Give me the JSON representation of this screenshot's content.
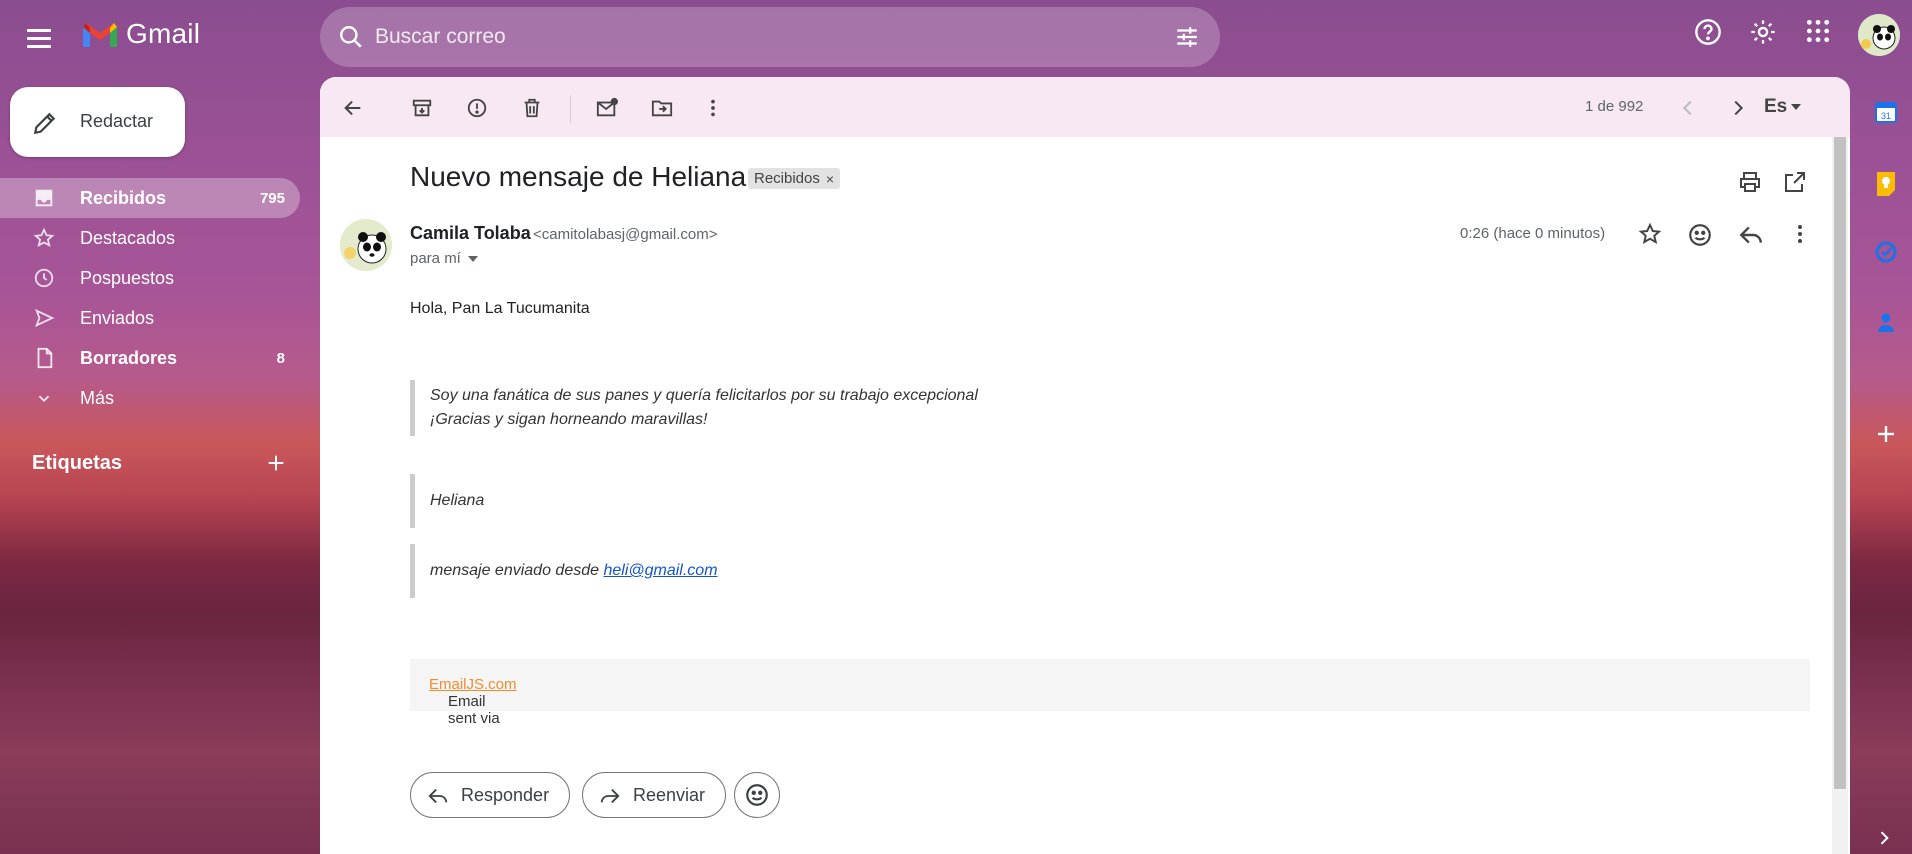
{
  "app": {
    "name": "Gmail"
  },
  "search": {
    "placeholder": "Buscar correo"
  },
  "compose": {
    "label": "Redactar"
  },
  "sidebar": {
    "items": [
      {
        "label": "Recibidos",
        "count": "795",
        "icon": "inbox-icon"
      },
      {
        "label": "Destacados",
        "count": "",
        "icon": "star-icon"
      },
      {
        "label": "Pospuestos",
        "count": "",
        "icon": "clock-icon"
      },
      {
        "label": "Enviados",
        "count": "",
        "icon": "send-icon"
      },
      {
        "label": "Borradores",
        "count": "8",
        "icon": "draft-icon"
      },
      {
        "label": "Más",
        "count": "",
        "icon": "chevron-down-icon"
      }
    ],
    "labels_heading": "Etiquetas"
  },
  "toolbar": {
    "pager": "1 de 992",
    "lang": "Es"
  },
  "email": {
    "subject": "Nuevo mensaje de Heliana",
    "label_chip": "Recibidos",
    "sender_name": "Camila Tolaba",
    "sender_email": "<camitolabasj@gmail.com>",
    "to": "para mí",
    "time": "0:26 (hace 0 minutos)",
    "greeting": "Hola, Pan La Tucumanita",
    "quote1_line1": "Soy una fanática de sus panes y quería felicitarlos por su trabajo excepcional",
    "quote1_line2": "¡Gracias y sigan horneando maravillas!",
    "quote2": "Heliana",
    "quote3_prefix": "mensaje enviado desde",
    "quote3_link": "heli@gmail.com",
    "footer_prefix": "Email sent via",
    "footer_link": "EmailJS.com"
  },
  "actions": {
    "reply": "Responder",
    "forward": "Reenviar"
  },
  "colors": {
    "accent_calendar": "#1a73e8",
    "keep_yellow": "#fbbc04",
    "footer_link": "#f08d2f",
    "link_blue": "#1155cc"
  }
}
